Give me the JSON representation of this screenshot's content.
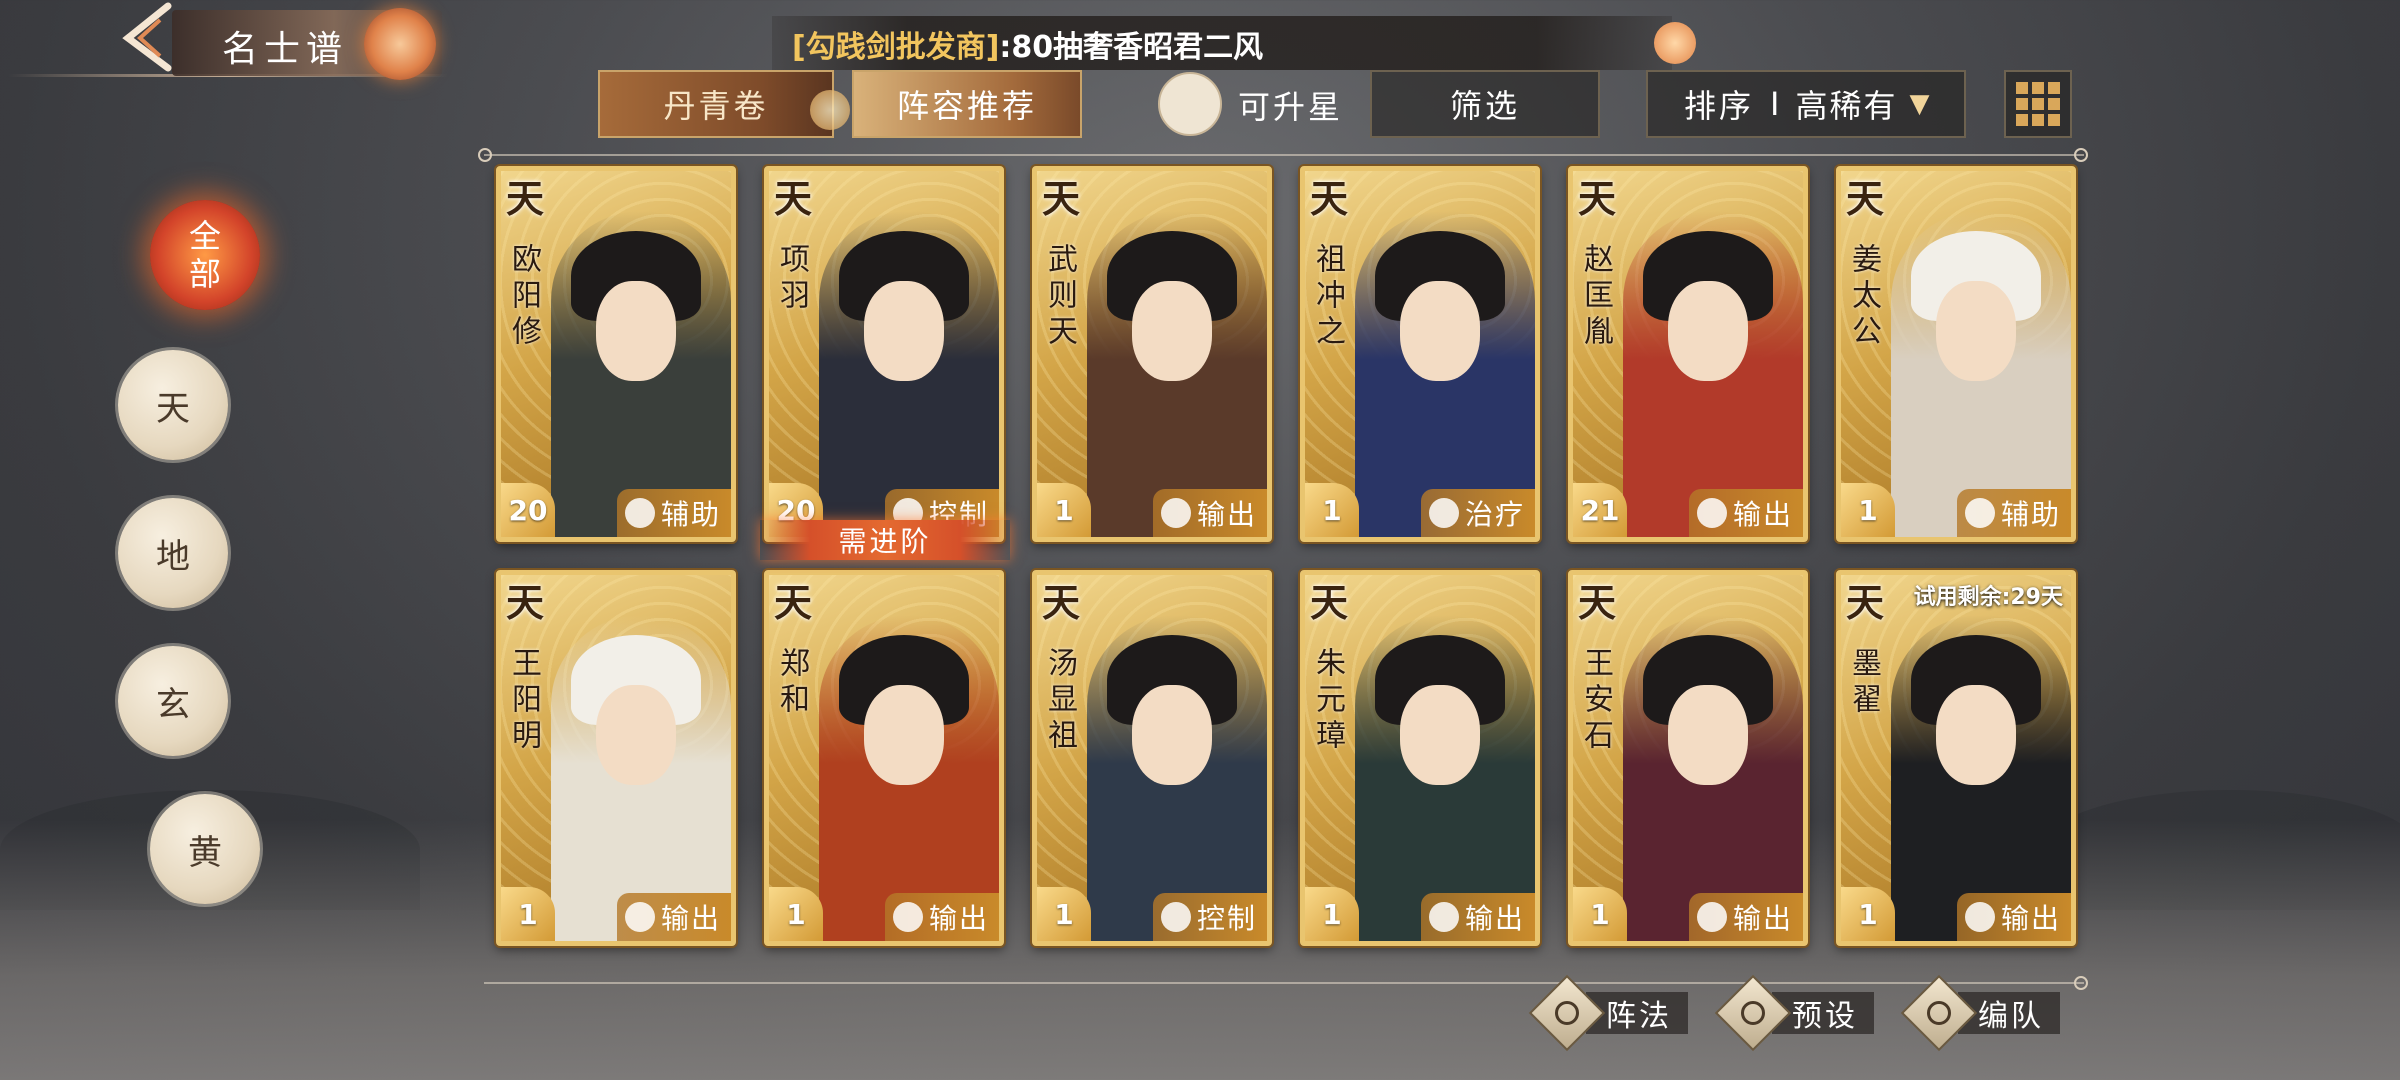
{
  "header": {
    "title": "名士谱",
    "back_icon": "back-arrow-icon",
    "marquee_prefix": "[勾践剑批发商]",
    "marquee_text": ":80抽奢香昭君二风"
  },
  "toolbar": {
    "tab_danqing": "丹青卷",
    "tab_recommend": "阵容推荐",
    "upgradable_label": "可升星",
    "filter_label": "筛选",
    "sort_label": "排序",
    "sort_separator": "I",
    "sort_value": "高稀有"
  },
  "ranks": [
    {
      "label": "全部",
      "active": true
    },
    {
      "label": "天",
      "active": false
    },
    {
      "label": "地",
      "active": false
    },
    {
      "label": "玄",
      "active": false
    },
    {
      "label": "黄",
      "active": false
    }
  ],
  "cards": [
    {
      "grade": "天",
      "name": "欧阳修",
      "level": "20",
      "role": "辅助",
      "palette": "#3a3f3b"
    },
    {
      "grade": "天",
      "name": "项羽",
      "level": "20",
      "role": "控制",
      "palette": "#2b2e3a"
    },
    {
      "grade": "天",
      "name": "武则天",
      "level": "1",
      "role": "输出",
      "palette": "#5a3a2a"
    },
    {
      "grade": "天",
      "name": "祖冲之",
      "level": "1",
      "role": "治疗",
      "palette": "#2a3566"
    },
    {
      "grade": "天",
      "name": "赵匡胤",
      "level": "21",
      "role": "输出",
      "palette": "#b23a2a"
    },
    {
      "grade": "天",
      "name": "姜太公",
      "level": "1",
      "role": "辅助",
      "palette": "#d9cfc0"
    },
    {
      "grade": "天",
      "name": "王阳明",
      "level": "1",
      "role": "输出",
      "palette": "#e6e0d2"
    },
    {
      "grade": "天",
      "name": "郑和",
      "level": "1",
      "role": "输出",
      "palette": "#b0401f"
    },
    {
      "grade": "天",
      "name": "汤显祖",
      "level": "1",
      "role": "控制",
      "palette": "#2f3a4a"
    },
    {
      "grade": "天",
      "name": "朱元璋",
      "level": "1",
      "role": "输出",
      "palette": "#2a3a38"
    },
    {
      "grade": "天",
      "name": "王安石",
      "level": "1",
      "role": "输出",
      "palette": "#5a2430"
    },
    {
      "grade": "天",
      "name": "墨翟",
      "level": "1",
      "role": "输出",
      "palette": "#1e1f22",
      "trial": "试用剩余:29天"
    }
  ],
  "advance_label": "需进阶",
  "bottom": {
    "formation": "阵法",
    "preset": "预设",
    "team": "编队"
  }
}
